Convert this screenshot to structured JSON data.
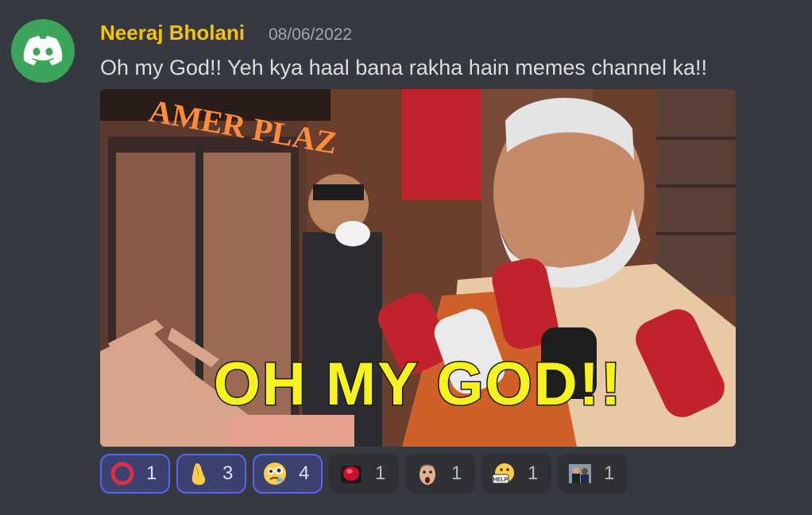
{
  "message": {
    "author": "Neeraj Bholani",
    "timestamp": "08/06/2022",
    "content": "Oh my God!! Yeh kya haal bana rakha hain memes channel ka!!"
  },
  "media": {
    "caption": "OH MY GOD!!",
    "storefront_sign": "AMER PLAZ"
  },
  "reactions": [
    {
      "icon": "red-circle-icon",
      "count": "1",
      "me": true
    },
    {
      "icon": "pinched-fingers-icon",
      "count": "3",
      "me": true
    },
    {
      "icon": "woozy-face-icon",
      "count": "4",
      "me": true
    },
    {
      "icon": "red-button-emoji-icon",
      "count": "1",
      "me": false
    },
    {
      "icon": "shocked-man-emoji-icon",
      "count": "1",
      "me": false
    },
    {
      "icon": "help-face-emoji-icon",
      "count": "1",
      "me": false
    },
    {
      "icon": "photo-emoji-icon",
      "count": "1",
      "me": false
    }
  ],
  "colors": {
    "background": "#36393f",
    "author": "#f1c40f",
    "avatar": "#3ba55c",
    "reaction_active_border": "#5865f2"
  }
}
